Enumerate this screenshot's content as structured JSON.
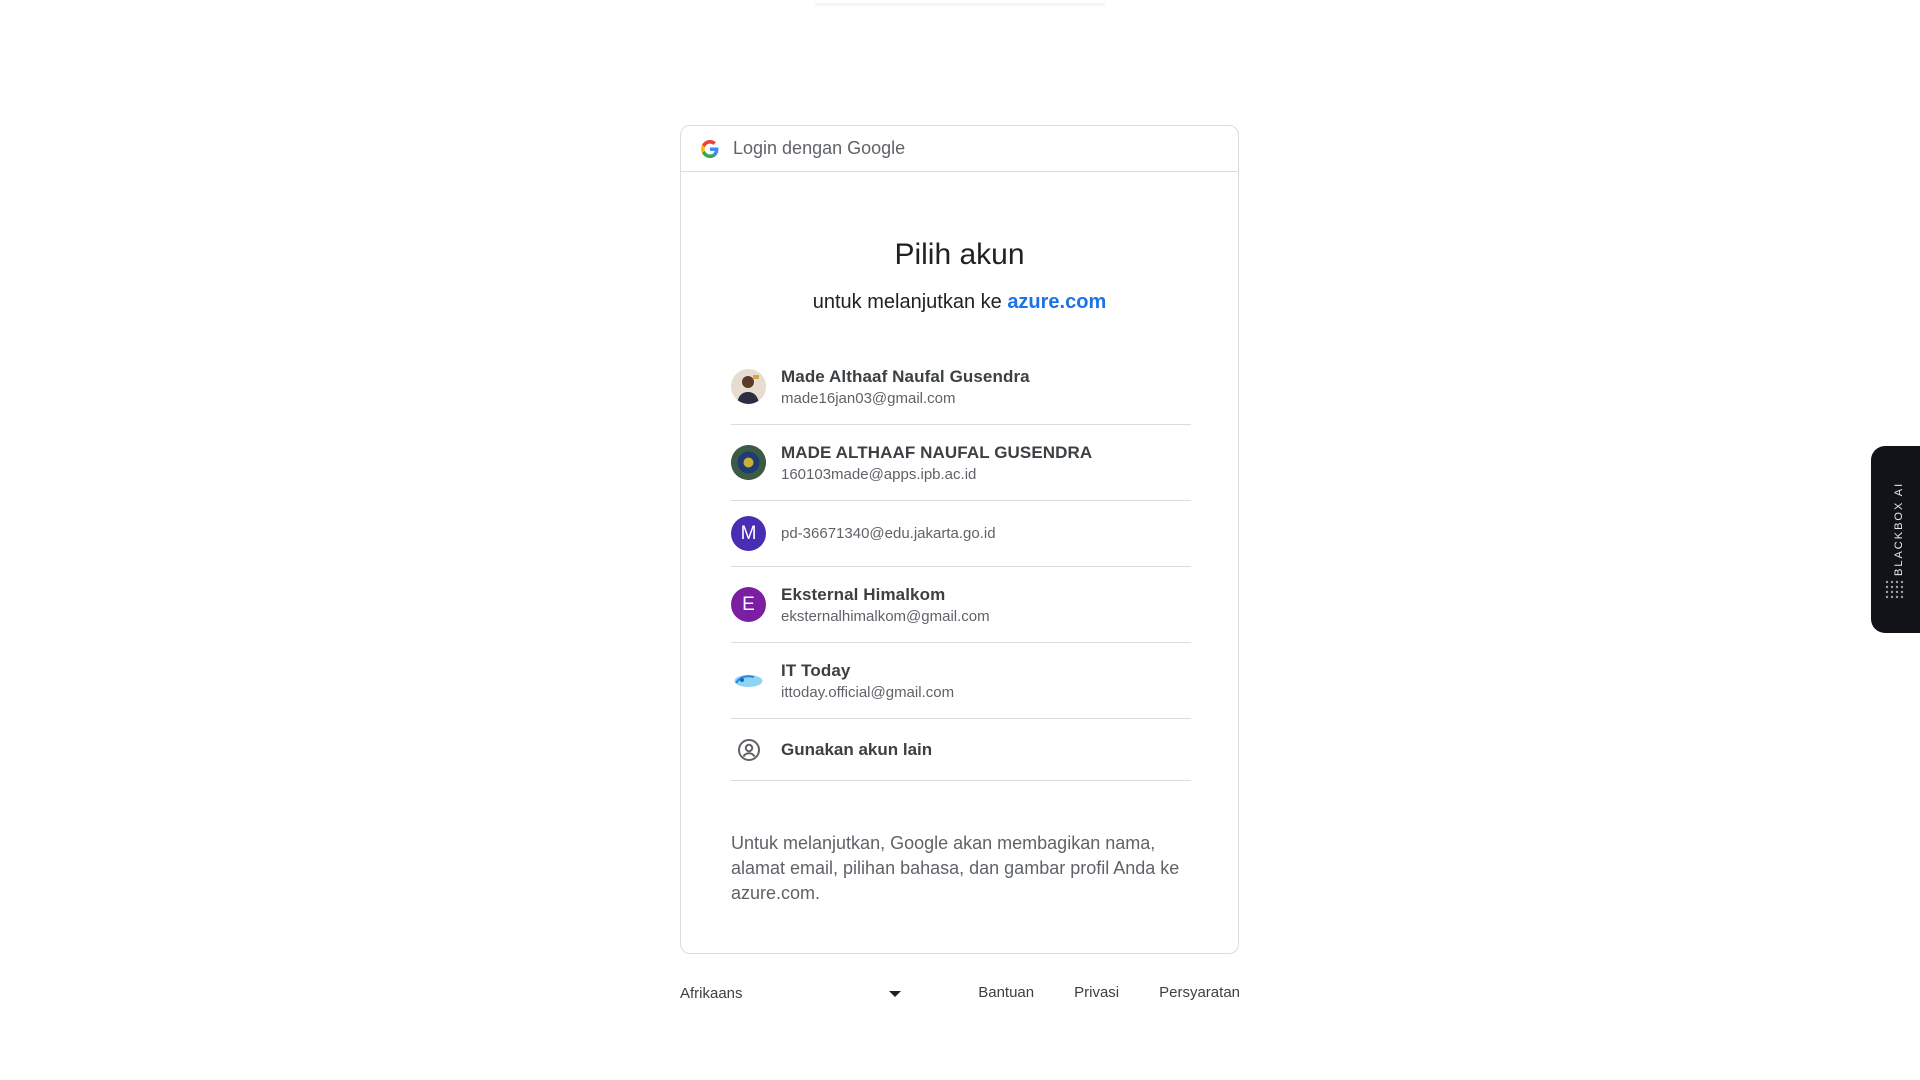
{
  "header": {
    "text": "Login dengan Google"
  },
  "title": "Pilih akun",
  "subtitle": {
    "prefix": "untuk melanjutkan ke ",
    "link": "azure.com"
  },
  "accounts": [
    {
      "name": "Made Althaaf Naufal Gusendra",
      "email": "made16jan03@gmail.com",
      "avatar": "photo"
    },
    {
      "name": "MADE ALTHAAF NAUFAL GUSENDRA",
      "email": "160103made@apps.ipb.ac.id",
      "avatar": "logo"
    },
    {
      "name": "",
      "email": "pd-36671340@edu.jakarta.go.id",
      "avatar": "M",
      "avatar_color": "#4a2db5"
    },
    {
      "name": "Eksternal Himalkom",
      "email": "eksternalhimalkom@gmail.com",
      "avatar": "E",
      "avatar_color": "#7b1fa2"
    },
    {
      "name": "IT Today",
      "email": "ittoday.official@gmail.com",
      "avatar": "logo-ittoday"
    }
  ],
  "other_account": {
    "label": "Gunakan akun lain",
    "icon": "account-circle-icon"
  },
  "disclaimer": "Untuk melanjutkan, Google akan membagikan nama, alamat email, pilihan bahasa, dan gambar profil Anda ke azure.com.",
  "footer": {
    "language": "Afrikaans",
    "links": [
      "Bantuan",
      "Privasi",
      "Persyaratan"
    ]
  },
  "blackbox": {
    "label": "BLACKBOX AI"
  },
  "colors": {
    "link": "#1a73e8",
    "divider": "#dadce0"
  }
}
